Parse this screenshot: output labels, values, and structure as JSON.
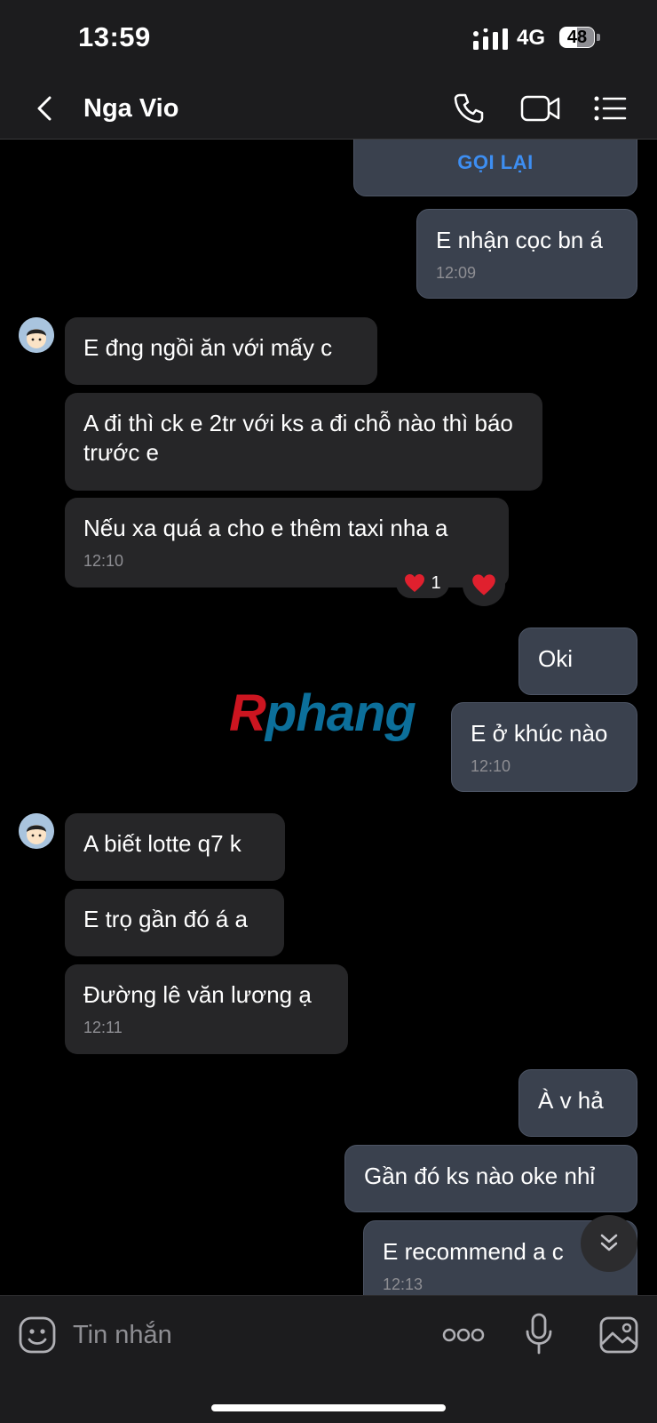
{
  "status": {
    "time": "13:59",
    "network": "4G",
    "battery": "48"
  },
  "header": {
    "contact_name": "Nga Vio",
    "icons": [
      "back-chevron-icon",
      "phone-icon",
      "video-camera-icon",
      "menu-list-icon"
    ]
  },
  "chat": {
    "call_back_label": "GỌI LẠI",
    "messages": [
      {
        "dir": "out",
        "text": "E nhận cọc bn á",
        "time": "12:09"
      },
      {
        "dir": "in",
        "text": "E đng ngồi ăn với mấy c"
      },
      {
        "dir": "in",
        "text": "A đi thì ck e 2tr với ks a đi chỗ nào thì báo trước e"
      },
      {
        "dir": "in",
        "text": "Nếu xa quá a cho e thêm taxi nha a",
        "time": "12:10",
        "reaction_count": "1"
      },
      {
        "dir": "out",
        "text": "Oki"
      },
      {
        "dir": "out",
        "text": "E ở khúc nào",
        "time": "12:10"
      },
      {
        "dir": "in",
        "text": "A biết lotte q7 k"
      },
      {
        "dir": "in",
        "text": "E trọ gần đó á a"
      },
      {
        "dir": "in",
        "text": "Đường lê văn lương ạ",
        "time": "12:11"
      },
      {
        "dir": "out",
        "text": "À v hả"
      },
      {
        "dir": "out",
        "text": "Gần đó ks nào oke nhỉ"
      },
      {
        "dir": "out",
        "text": "E recommend a c",
        "time": "12:13"
      }
    ]
  },
  "watermark": {
    "first": "R",
    "rest": "phang"
  },
  "input": {
    "placeholder": "Tin nhắn"
  },
  "colors": {
    "accent": "#3d8ef2",
    "incoming_bubble": "#262628",
    "outgoing_bubble": "#3a414e",
    "heart": "#e0202e"
  }
}
